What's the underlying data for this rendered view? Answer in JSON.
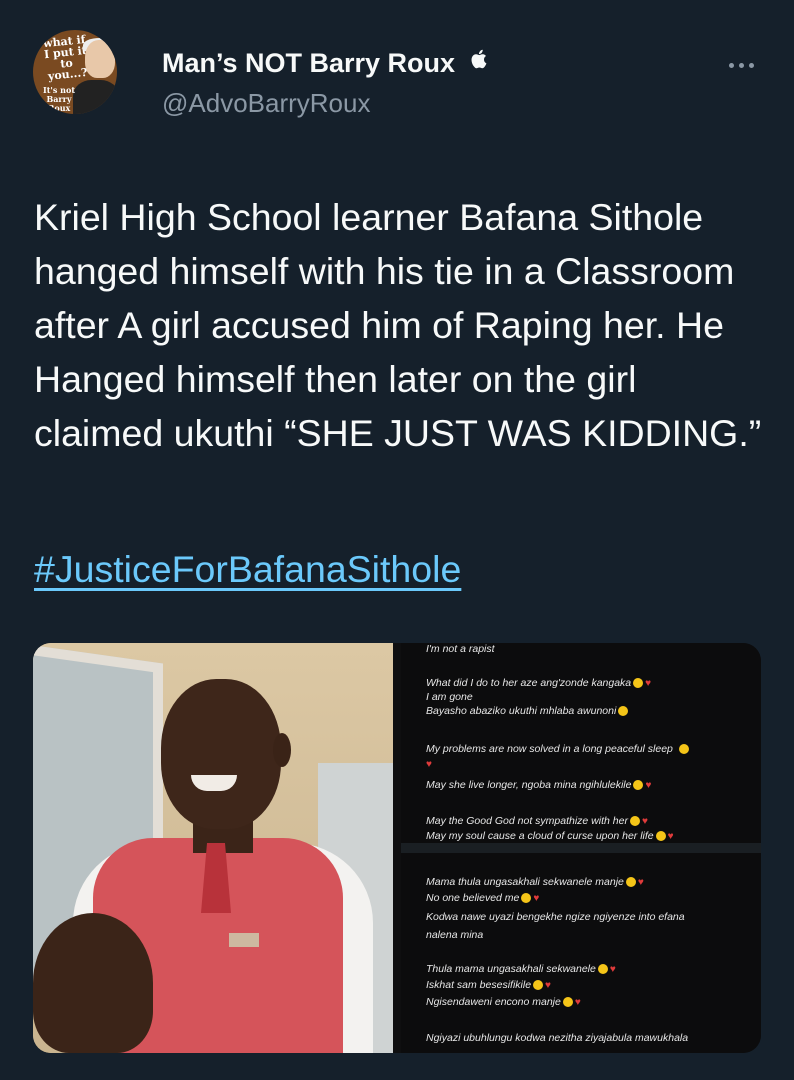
{
  "header": {
    "avatar_text_top": "what if I put it to you...?",
    "avatar_text_bottom": "It's not Barry Roux",
    "display_name": "Man’s NOT Barry Roux",
    "handle": "@AdvoBarryRoux",
    "verified_icon": "apple-icon"
  },
  "tweet": {
    "text": "Kriel High School learner Bafana Sithole hanged himself with his tie in a Classroom after A girl accused him of Raping her. He Hanged himself then later on the girl claimed ukuthi “SHE JUST WAS KIDDING.”",
    "hashtag": "#JusticeForBafanaSithole"
  },
  "messages": [
    "I'm not a rapist",
    "What did I do to her aze ang'zonde kangaka",
    "I am gone",
    "Bayasho abaziko ukuthi mhlaba awunoni",
    "My problems are now solved in a long peaceful sleep",
    "May she live longer, ngoba mina ngihlulekile",
    "May the Good God not sympathize with her",
    "May my soul cause a cloud of curse upon her life",
    "Mama thula ungasakhali sekwanele manje",
    "No one believed me",
    "Kodwa nawe uyazi bengekhe ngize ngiyenze into efana",
    "nalena mina",
    "Thula mama ungasakhali sekwanele",
    "Iskhat sam besesifikile",
    "Ngisendaweni encono manje",
    "Ngiyazi ubuhlungu kodwa nezitha ziyajabula mawukhala"
  ]
}
